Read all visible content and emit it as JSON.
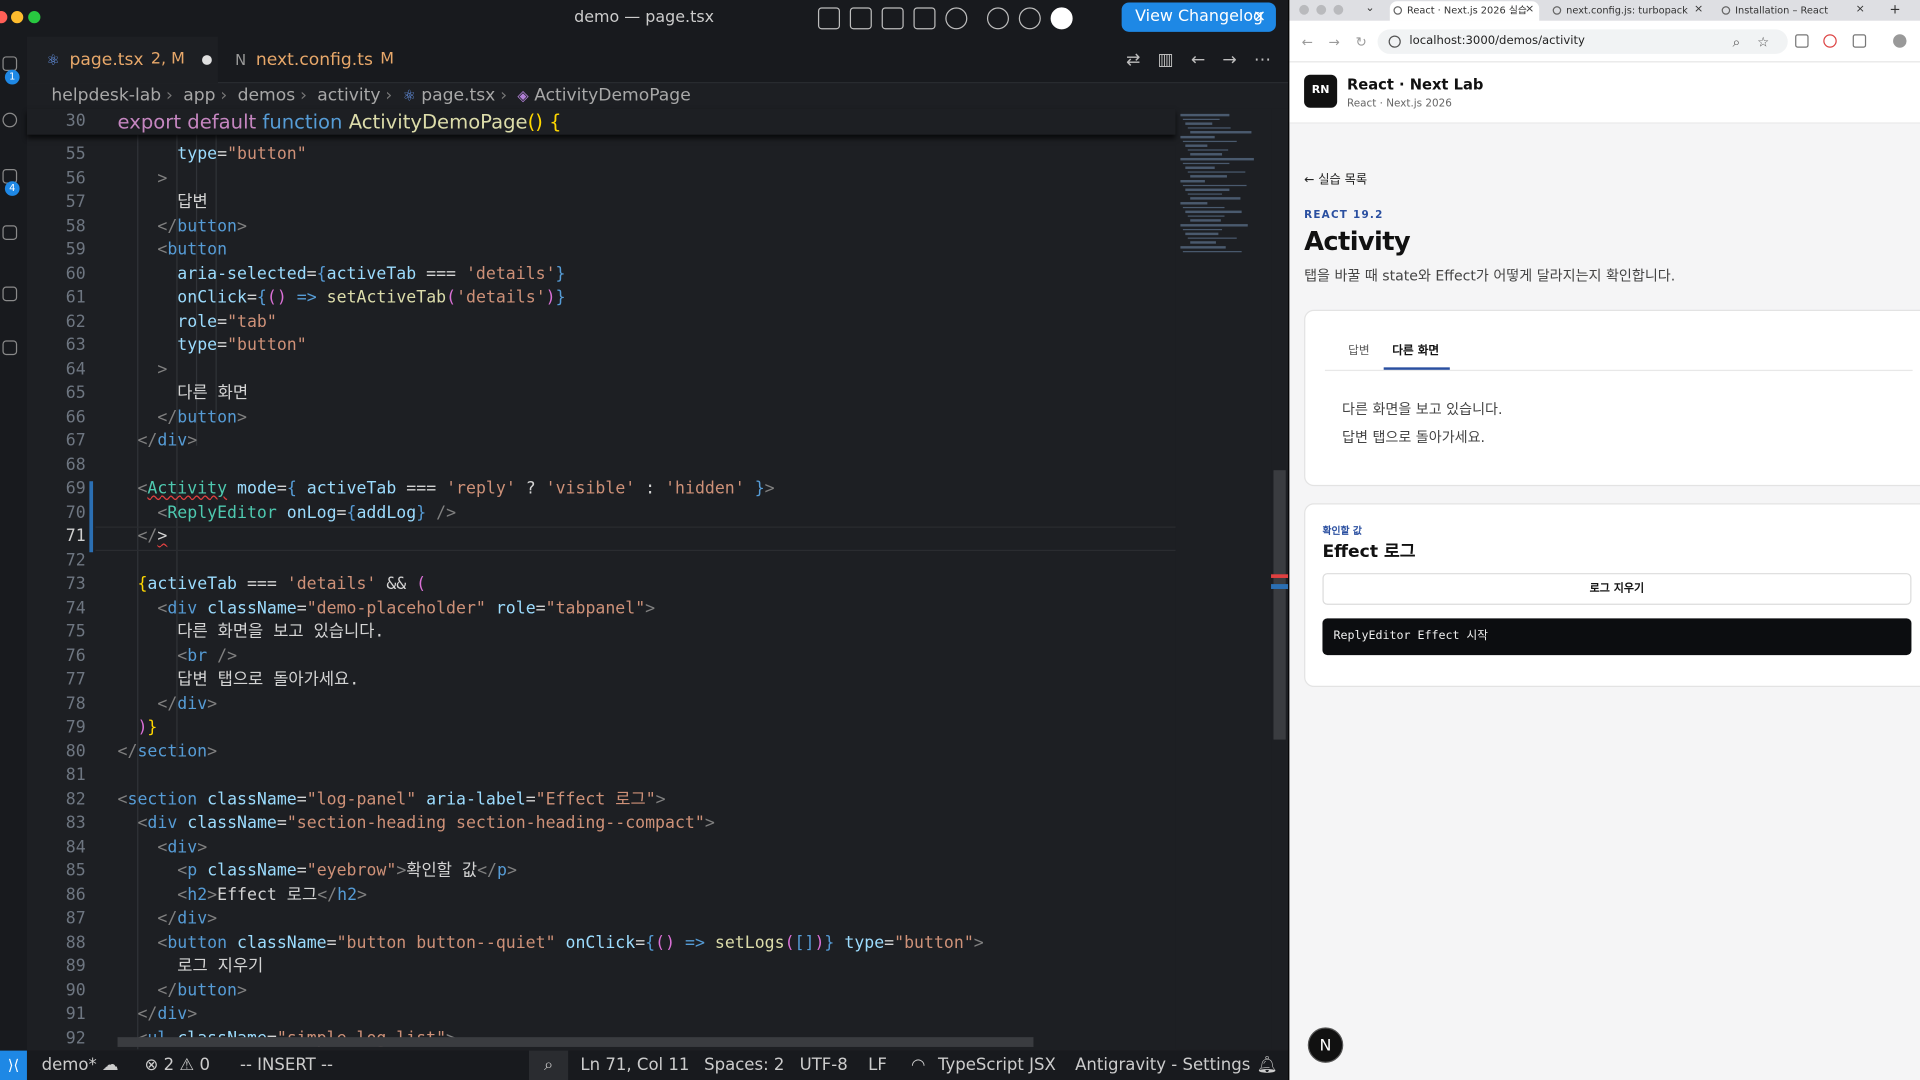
{
  "window": {
    "title": "demo — page.tsx",
    "changelog_button": "View Changelog",
    "close": "×"
  },
  "tabs": [
    {
      "label": "page.tsx",
      "status": "2, M",
      "icon": "⚛"
    },
    {
      "label": "next.config.ts",
      "status": "M",
      "icon": "N"
    }
  ],
  "breadcrumb": [
    "helpdesk-lab",
    "app",
    "demos",
    "activity",
    "page.tsx",
    "ActivityDemoPage"
  ],
  "activity_badges": [
    "1",
    "4"
  ],
  "sticky": {
    "number": "30"
  },
  "editor": {
    "line_numbers": [
      "55",
      "56",
      "57",
      "58",
      "59",
      "60",
      "61",
      "62",
      "63",
      "64",
      "65",
      "66",
      "67",
      "68",
      "69",
      "70",
      "71",
      "72",
      "73",
      "74",
      "75",
      "76",
      "77",
      "78",
      "79",
      "80",
      "81",
      "82",
      "83",
      "84",
      "85",
      "86",
      "87",
      "88",
      "89",
      "90",
      "91",
      "92"
    ],
    "current_line": "71"
  },
  "statusbar": {
    "branch": "demo*",
    "errors": "2",
    "warnings": "0",
    "mode": "-- INSERT --",
    "position": "Ln 71, Col 11",
    "spaces": "Spaces: 2",
    "encoding": "UTF-8",
    "eol": "LF",
    "language": "TypeScript JSX",
    "extension": "Antigravity - Settings"
  },
  "browser": {
    "tabs": [
      "React · Next.js 2026 실습",
      "next.config.js: turbopack",
      "Installation – React"
    ],
    "url": "localhost:3000/demos/activity",
    "brand": {
      "logo": "RN",
      "name": "React · Next Lab",
      "sub": "React · Next.js 2026"
    },
    "back_link": "← 실습 목록",
    "eyebrow": "REACT 19.2",
    "title": "Activity",
    "description": "탭을 바꿀 때 state와 Effect가 어떻게 달라지는지 확인합니다.",
    "demo_tabs": [
      {
        "label": "답변"
      },
      {
        "label": "다른 화면"
      }
    ],
    "panel_lines": [
      "다른 화면을 보고 있습니다.",
      "답변 탭으로 돌아가세요."
    ],
    "log": {
      "eyebrow": "확인할 값",
      "title": "Effect 로그",
      "clear": "로그 지우기",
      "items": [
        "ReplyEditor Effect 시작"
      ]
    },
    "next_badge": "N"
  },
  "colors": {
    "accent": "#1e88e5",
    "editor_bg": "#1d1f23",
    "link_blue": "#2a4fa0"
  }
}
